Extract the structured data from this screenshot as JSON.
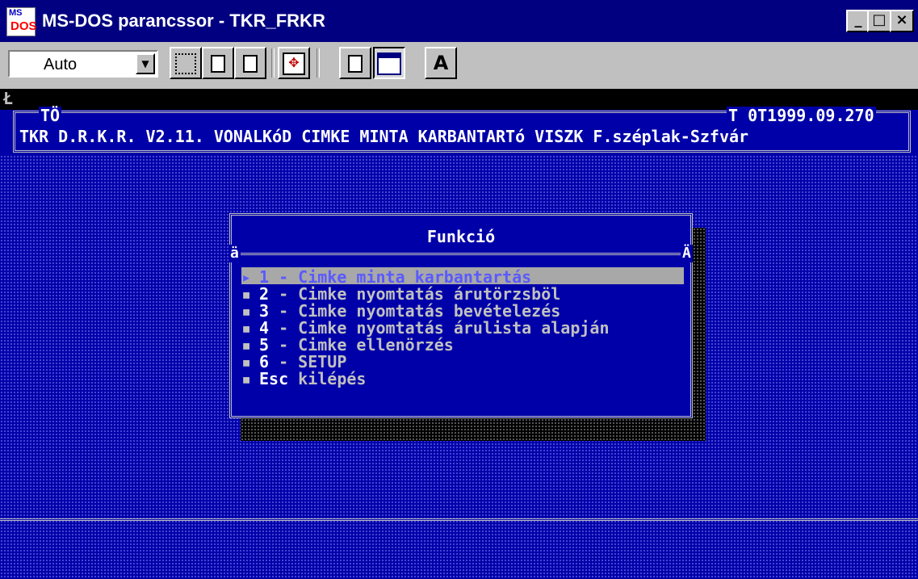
{
  "window": {
    "title": "MS-DOS parancssor - TKR_FRKR",
    "icon_top": "MS",
    "icon_bottom": "DOS",
    "min_glyph": "_",
    "max_glyph": "□",
    "close_glyph": "×"
  },
  "toolbar": {
    "font_size": "Auto",
    "dropdown_glyph": "▼",
    "font_button": "A",
    "fullscreen_glyph": "✥"
  },
  "console": {
    "cursor": "Ł",
    "header_left": "TÖ",
    "header_right": "T 0T1999.09.270",
    "header_line": "TKR D.R.K.R. V2.11. VONALKóD CIMKE MINTA KARBANTARTó  VISZK F.széplak-Szfvár"
  },
  "dialog": {
    "title": "Funkció",
    "left_marker": "ä",
    "right_marker": "Ä",
    "items": [
      {
        "bullet": "▸",
        "key": "1",
        "label": " - Cimke minta karbantartás"
      },
      {
        "bullet": "▪",
        "key": "2",
        "label": " - Cimke nyomtatás árutörzsböl"
      },
      {
        "bullet": "▪",
        "key": "3",
        "label": " - Cimke nyomtatás bevételezés"
      },
      {
        "bullet": "▪",
        "key": "4",
        "label": " - Cimke nyomtatás árulista alapján"
      },
      {
        "bullet": "▪",
        "key": "5",
        "label": " - Cimke ellenörzés"
      },
      {
        "bullet": "▪",
        "key": "6",
        "label": " - SETUP"
      },
      {
        "bullet": "▪",
        "key": "Esc",
        "label": " kilépés"
      }
    ]
  },
  "colors": {
    "title_bar": "#000080",
    "console_bg": "#0000a8",
    "selection_bg": "#a8a8a8",
    "selection_fg": "#5a5aff"
  }
}
